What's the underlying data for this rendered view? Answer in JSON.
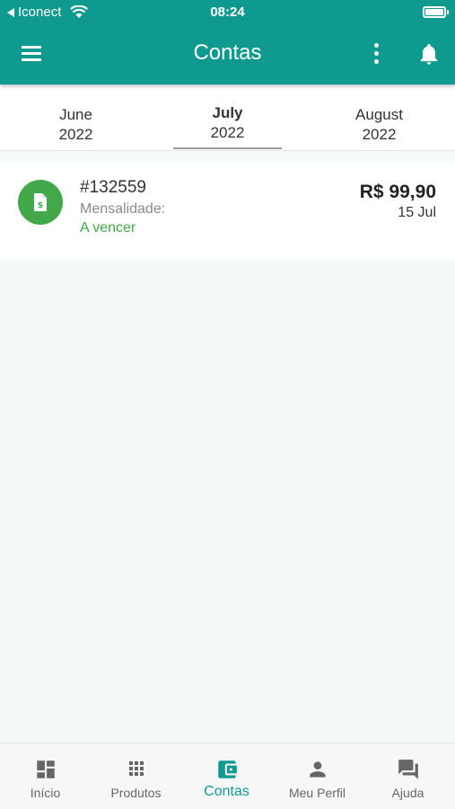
{
  "status_bar": {
    "carrier": "Iconect",
    "time": "08:24"
  },
  "header": {
    "title": "Contas"
  },
  "months": [
    {
      "month": "June",
      "year": "2022",
      "selected": false
    },
    {
      "month": "July",
      "year": "2022",
      "selected": true
    },
    {
      "month": "August",
      "year": "2022",
      "selected": false
    }
  ],
  "bills": [
    {
      "number": "#132559",
      "description": "Mensalidade:",
      "status": "A vencer",
      "amount": "R$ 99,90",
      "due_date": "15 Jul",
      "icon": "invoice-dollar-icon"
    }
  ],
  "bottom_nav": {
    "items": [
      {
        "label": "Início",
        "icon": "dashboard-icon"
      },
      {
        "label": "Produtos",
        "icon": "grid-icon"
      },
      {
        "label": "Contas",
        "icon": "wallet-icon",
        "active": true
      },
      {
        "label": "Meu Perfil",
        "icon": "person-icon"
      },
      {
        "label": "Ajuda",
        "icon": "chat-icon"
      }
    ]
  },
  "colors": {
    "primary": "#0e9a8e",
    "success": "#43a84a",
    "background": "#f4fafa"
  }
}
